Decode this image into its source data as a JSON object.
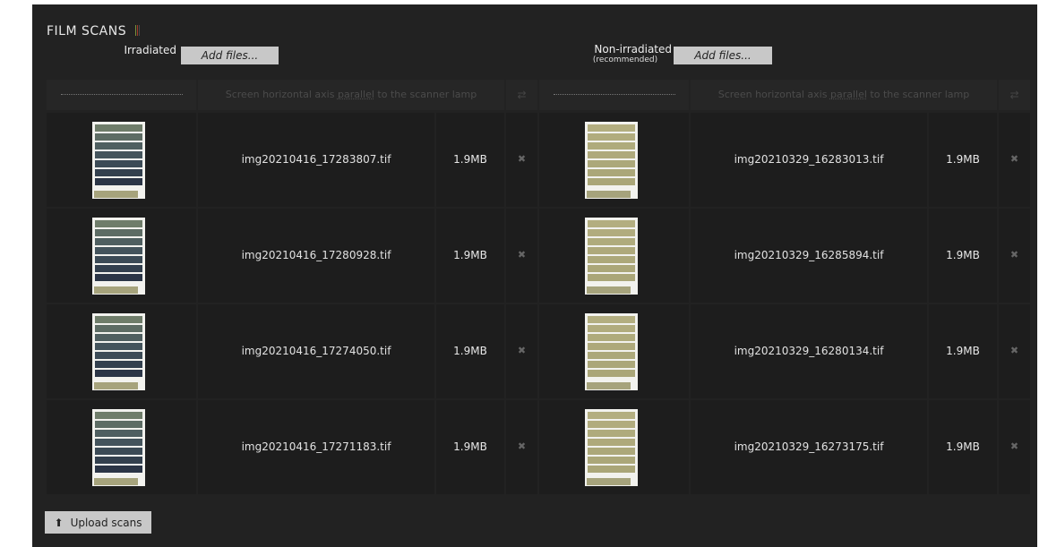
{
  "section": {
    "title": "FILM SCANS",
    "title_bar_colors": [
      "#7a8f3a",
      "#a03a2a",
      "#4a4a4a"
    ]
  },
  "irradiated": {
    "label": "Irradiated",
    "add_label": "Add files..."
  },
  "non_irradiated": {
    "label": "Non-irradiated",
    "sublabel": "(recommended)",
    "add_label": "Add files..."
  },
  "table_header": {
    "dots": "...................................",
    "axis_prefix": "Screen horizontal axis ",
    "axis_link": "parallel",
    "axis_suffix": " to the scanner lamp",
    "rotate_icon": "rotate-icon"
  },
  "irradiated_files": [
    {
      "name": "img20210416_17283807.tif",
      "size": "1.9MB",
      "remove": "✖"
    },
    {
      "name": "img20210416_17280928.tif",
      "size": "1.9MB",
      "remove": "✖"
    },
    {
      "name": "img20210416_17274050.tif",
      "size": "1.9MB",
      "remove": "✖"
    },
    {
      "name": "img20210416_17271183.tif",
      "size": "1.9MB",
      "remove": "✖"
    }
  ],
  "non_irradiated_files": [
    {
      "name": "img20210329_16283013.tif",
      "size": "1.9MB",
      "remove": "✖"
    },
    {
      "name": "img20210329_16285894.tif",
      "size": "1.9MB",
      "remove": "✖"
    },
    {
      "name": "img20210329_16280134.tif",
      "size": "1.9MB",
      "remove": "✖"
    },
    {
      "name": "img20210329_16273175.tif",
      "size": "1.9MB",
      "remove": "✖"
    }
  ],
  "thumb_colors": {
    "irradiated": [
      "#6f7d6a",
      "#5d6c64",
      "#4f5f60",
      "#44545c",
      "#3c4b56",
      "#33404e",
      "#2b3546"
    ],
    "non_irradiated": [
      "#b3ae80",
      "#b1ac7e",
      "#afab7c",
      "#aea97b",
      "#aca87a",
      "#aba779",
      "#aaa678"
    ],
    "base_strip": "#a6a37c"
  },
  "upload": {
    "label": "Upload scans",
    "icon": "upload-icon"
  }
}
